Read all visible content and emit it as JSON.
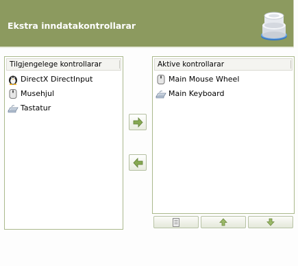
{
  "header": {
    "title": "Ekstra inndatakontrollarar",
    "icon": "input-controllers-stack-icon"
  },
  "available_panel": {
    "header": "Tilgjengelege kontrollarar",
    "items": [
      {
        "label": "DirectX DirectInput",
        "icon": "directx-penguin-icon"
      },
      {
        "label": "Musehjul",
        "icon": "mouse-icon"
      },
      {
        "label": "Tastatur",
        "icon": "keyboard-icon"
      }
    ]
  },
  "active_panel": {
    "header": "Aktive kontrollarar",
    "items": [
      {
        "label": "Main Mouse Wheel",
        "icon": "mouse-icon"
      },
      {
        "label": "Main Keyboard",
        "icon": "keyboard-icon"
      }
    ]
  },
  "buttons": {
    "add": "arrow-right-icon",
    "remove": "arrow-left-icon",
    "configure": "properties-icon",
    "move_up": "arrow-up-icon",
    "move_down": "arrow-down-icon"
  },
  "colors": {
    "header_bg": "#8c9a5f",
    "border_green": "#a9b88b",
    "arrow_green": "#7a9a4a"
  }
}
